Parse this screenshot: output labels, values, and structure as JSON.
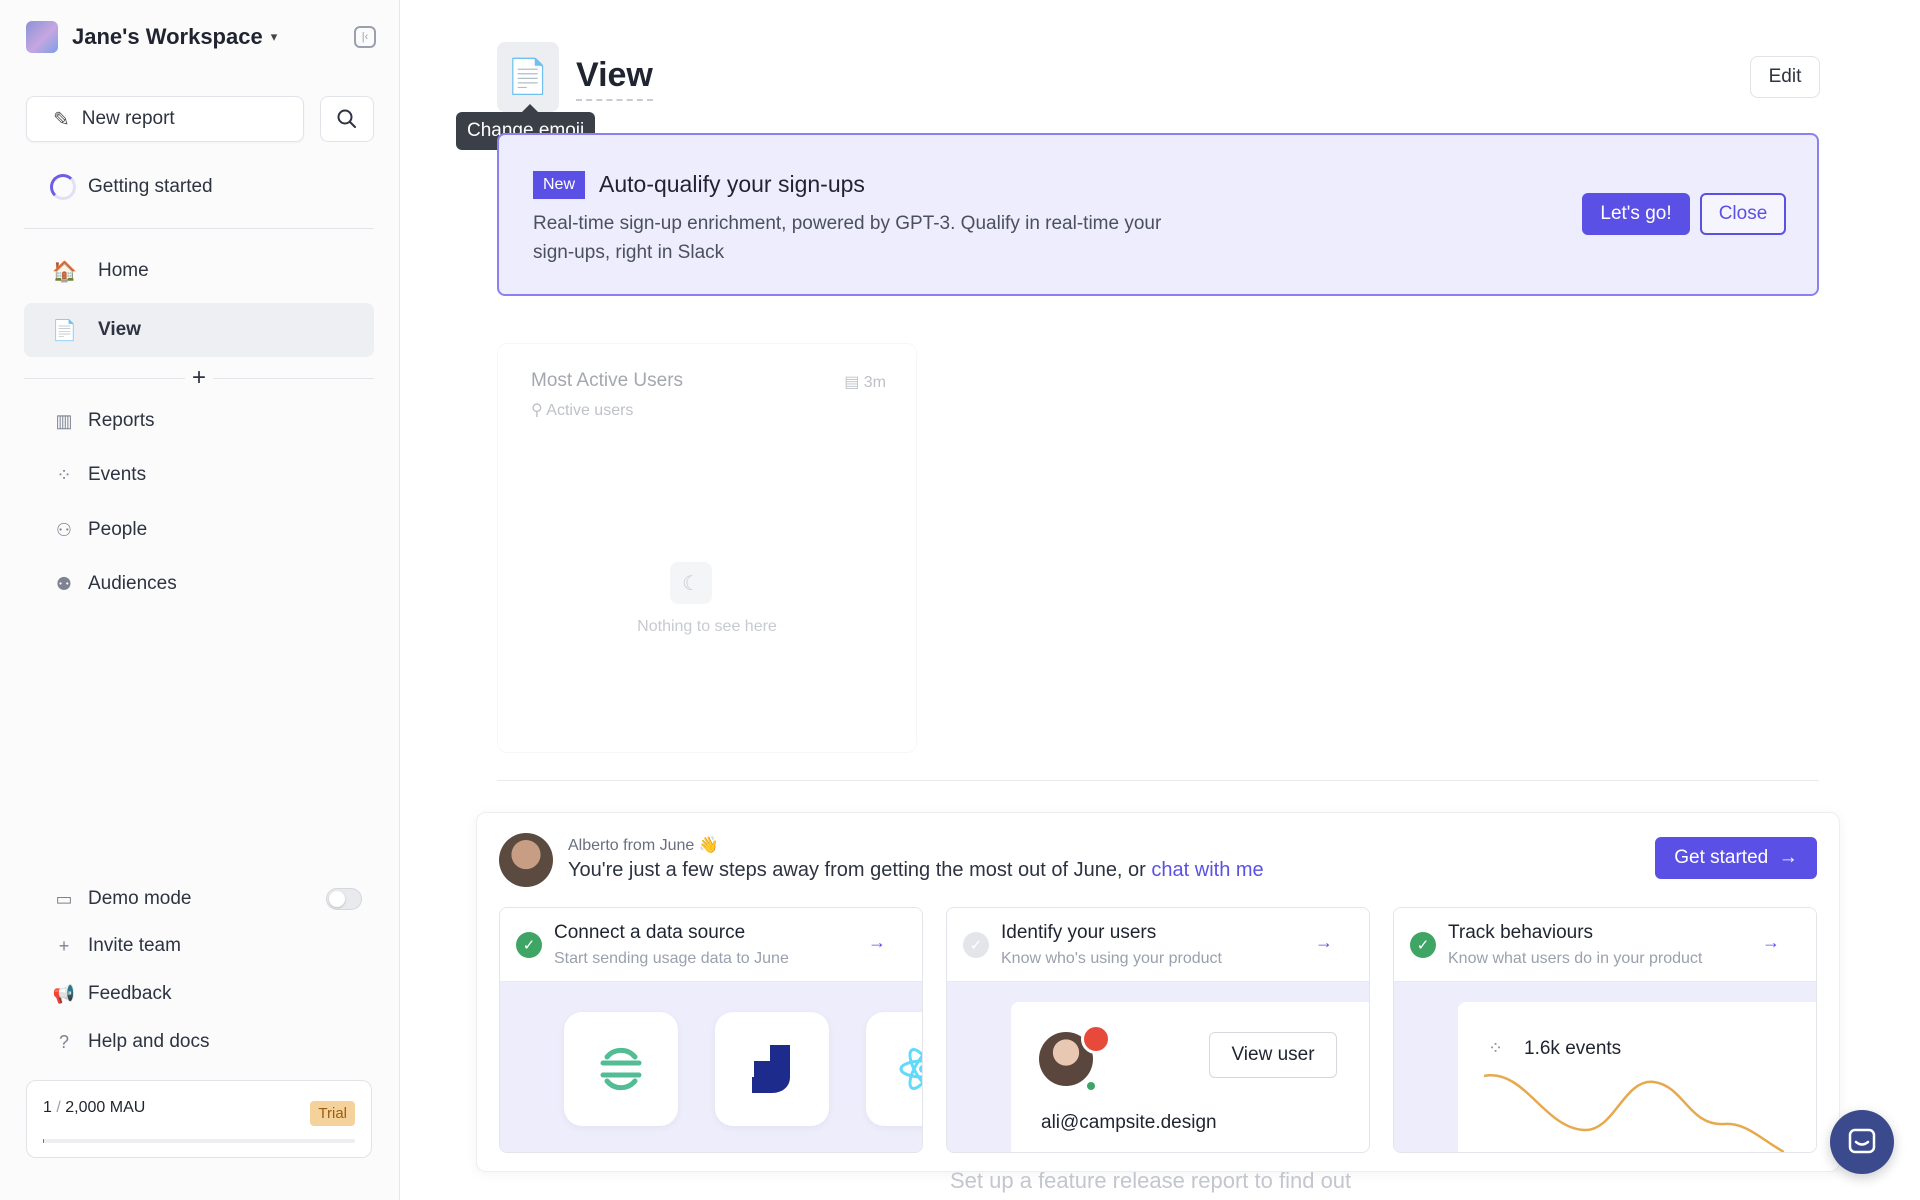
{
  "sidebar": {
    "workspace_name": "Jane's Workspace",
    "new_report_label": "New report",
    "getting_started_label": "Getting started",
    "pinned": [
      {
        "label": "Home",
        "icon": "house-icon"
      },
      {
        "label": "View",
        "icon": "document-icon"
      }
    ],
    "menu": [
      {
        "label": "Reports",
        "icon": "reports-icon"
      },
      {
        "label": "Events",
        "icon": "events-icon"
      },
      {
        "label": "People",
        "icon": "people-icon"
      },
      {
        "label": "Audiences",
        "icon": "audiences-icon"
      }
    ],
    "bottom": [
      {
        "label": "Demo mode",
        "icon": "browser-icon"
      },
      {
        "label": "Invite team",
        "icon": "plus-icon"
      },
      {
        "label": "Feedback",
        "icon": "megaphone-icon"
      },
      {
        "label": "Help and docs",
        "icon": "help-icon"
      }
    ],
    "demo_mode_on": false,
    "mau": {
      "used": "1",
      "limit": "2,000 MAU",
      "badge": "Trial",
      "usage_fraction": 0.0005
    }
  },
  "header": {
    "title": "View",
    "tooltip": "Change emoji",
    "edit_label": "Edit"
  },
  "banner": {
    "badge": "New",
    "title": "Auto-qualify your sign-ups",
    "description": "Real-time sign-up enrichment, powered by GPT-3. Qualify in real-time your sign-ups, right in Slack",
    "primary_label": "Let's go!",
    "secondary_label": "Close"
  },
  "report_card": {
    "title": "Most Active Users",
    "time": "3m",
    "subtitle": "Active users",
    "empty_text": "Nothing to see here"
  },
  "onboarding": {
    "from": "Alberto from June 👋",
    "message": "You're just a few steps away from getting the most out of June, or",
    "link": "chat with me",
    "cta_label": "Get started",
    "steps": [
      {
        "title": "Connect a data source",
        "subtitle": "Start sending usage data to June",
        "done": true
      },
      {
        "title": "Identify your users",
        "subtitle": "Know who's using your product",
        "done": false
      },
      {
        "title": "Track behaviours",
        "subtitle": "Know what users do in your product",
        "done": true
      }
    ],
    "view_user_label": "View user",
    "user_email": "ali@campsite.design",
    "events_label": "1.6k events"
  },
  "footer_text": "Set up a feature release report to find out",
  "colors": {
    "accent": "#5b50e6",
    "success": "#3ea565",
    "banner_bg": "#eeedfd"
  }
}
